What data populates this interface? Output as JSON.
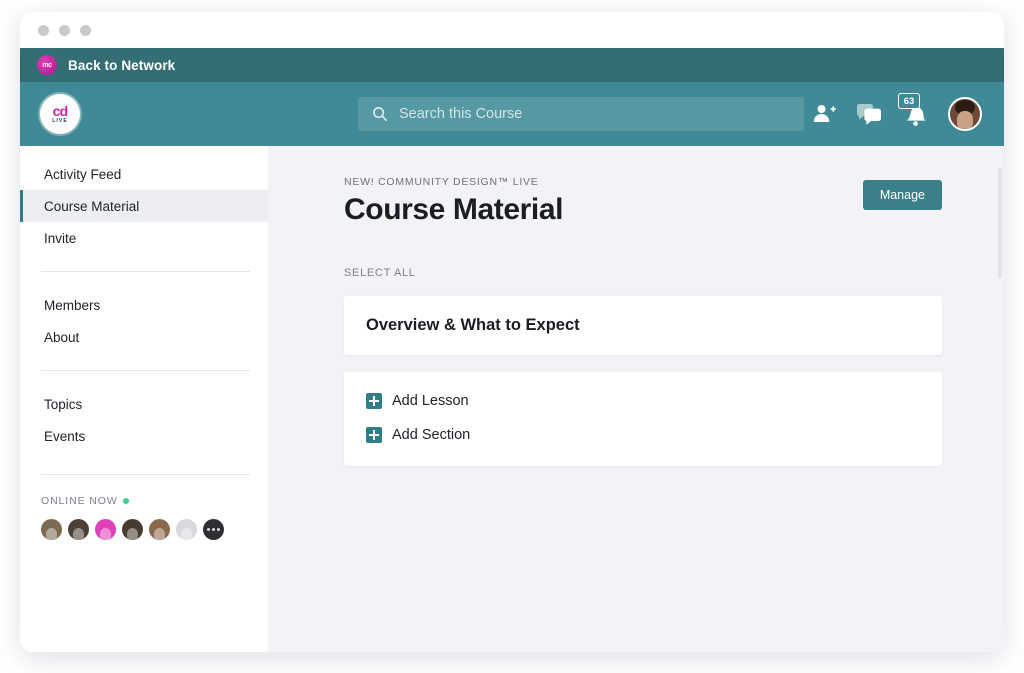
{
  "window": {
    "dots": [
      "close",
      "minimize",
      "maximize"
    ]
  },
  "topbar": {
    "back_label": "Back to Network",
    "brand_logo": {
      "primary": "cd",
      "secondary": "LIVE"
    },
    "network_logo": "mc"
  },
  "search": {
    "placeholder": "Search this Course",
    "value": "",
    "icon": "search-icon"
  },
  "header_icons": [
    {
      "name": "add-person-icon"
    },
    {
      "name": "messages-icon"
    },
    {
      "name": "notifications-bell-icon",
      "badge": "63"
    },
    {
      "name": "user-avatar"
    }
  ],
  "sidebar": {
    "items": [
      {
        "label": "Activity Feed",
        "active": false
      },
      {
        "label": "Course Material",
        "active": true
      },
      {
        "label": "Invite",
        "active": false
      },
      {
        "label": "Members",
        "active": false
      },
      {
        "label": "About",
        "active": false
      },
      {
        "label": "Topics",
        "active": false
      },
      {
        "label": "Events",
        "active": false
      }
    ],
    "online": {
      "title": "ONLINE NOW",
      "status_color": "#3ecf8e",
      "avatars": [
        {
          "name": "member-1",
          "color": "#7d6a52"
        },
        {
          "name": "member-2",
          "color": "#4d4136"
        },
        {
          "name": "member-3",
          "color": "#e040b8"
        },
        {
          "name": "member-4",
          "color": "#473a2e"
        },
        {
          "name": "member-5",
          "color": "#8a6a4a"
        },
        {
          "name": "member-6",
          "color": "#d8d8de"
        },
        {
          "name": "member-more",
          "color": "#2e2e33"
        }
      ]
    }
  },
  "collapse_tab": {
    "icon": "chevron-left-icon"
  },
  "main": {
    "eyebrow": "NEW! COMMUNITY DESIGN™ LIVE",
    "title": "Course Material",
    "manage_label": "Manage",
    "select_all_label": "SELECT ALL",
    "sections": [
      {
        "title": "Overview & What to Expect"
      }
    ],
    "actions": [
      {
        "label": "Add Lesson",
        "icon": "plus-square-icon"
      },
      {
        "label": "Add Section",
        "icon": "plus-square-icon"
      }
    ]
  },
  "colors": {
    "teal_dark": "#336e75",
    "teal": "#3f8a96",
    "teal_accent": "#2f7d86",
    "magenta": "#d41fa6",
    "bg": "#f2f2f7"
  }
}
